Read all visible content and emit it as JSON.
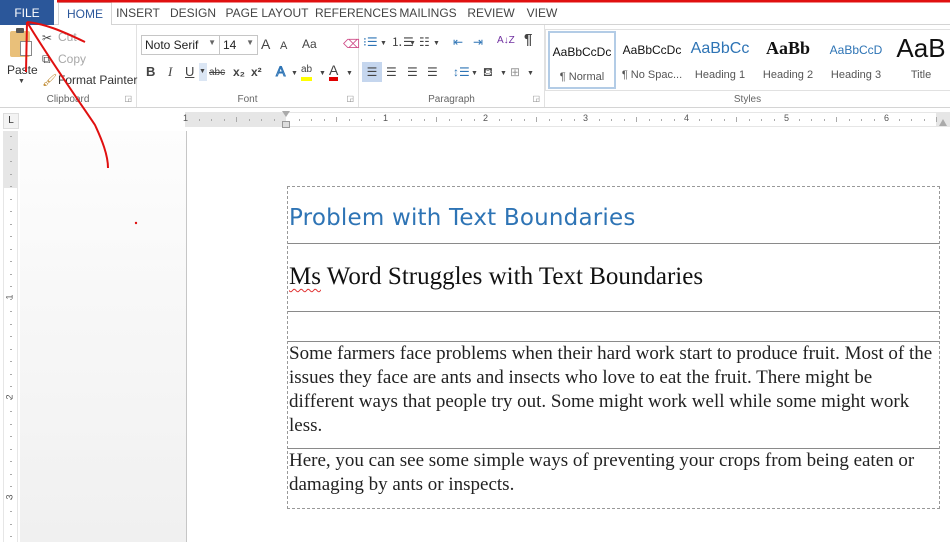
{
  "tabs": [
    {
      "label": "FILE"
    },
    {
      "label": "HOME"
    },
    {
      "label": "INSERT"
    },
    {
      "label": "DESIGN"
    },
    {
      "label": "PAGE LAYOUT"
    },
    {
      "label": "REFERENCES"
    },
    {
      "label": "MAILINGS"
    },
    {
      "label": "REVIEW"
    },
    {
      "label": "VIEW"
    }
  ],
  "active_tab": "HOME",
  "clipboard": {
    "paste": "Paste",
    "cut": "Cut",
    "copy": "Copy",
    "format_painter": "Format Painter",
    "group_label": "Clipboard"
  },
  "font": {
    "family": "Noto Serif",
    "size": "14",
    "grow": "A",
    "shrink": "A",
    "change_case": "Aa",
    "bold": "B",
    "italic": "I",
    "underline": "U",
    "strikethrough": "abc",
    "subscript": "x₂",
    "superscript": "x²",
    "text_effects": "A",
    "highlight": "ab",
    "font_color": "A",
    "group_label": "Font",
    "highlight_color": "#ffff00",
    "font_color_value": "#e00000"
  },
  "paragraph": {
    "group_label": "Paragraph",
    "sort": "A↓Z",
    "show_marks": "¶"
  },
  "styles": {
    "group_label": "Styles",
    "items": [
      {
        "preview": "AaBbCcDc",
        "name": "¶ Normal",
        "selected": true
      },
      {
        "preview": "AaBbCcDc",
        "name": "¶ No Spac..."
      },
      {
        "preview": "AaBbCc",
        "name": "Heading 1"
      },
      {
        "preview": "AaBb",
        "name": "Heading 2"
      },
      {
        "preview": "AaBbCcD",
        "name": "Heading 3"
      },
      {
        "preview": "AaB",
        "name": "Title"
      }
    ]
  },
  "ruler": {
    "corner": "L",
    "h_labels": [
      "1",
      "1",
      "2",
      "3",
      "4",
      "5",
      "6"
    ],
    "v_labels": [
      "1",
      "2",
      "3"
    ]
  },
  "document": {
    "heading": "Problem with Text Boundaries",
    "subtitle_misspelled": "Ms",
    "subtitle_rest": " Word Struggles with Text Boundaries",
    "paragraph1": "Some farmers face problems when their hard work start to produce fruit. Most of the issues they face are ants and insects who love to eat the fruit. There might be different ways that people try out. Some might work well while some might work less.",
    "paragraph2": "Here, you can see some simple ways of preventing your crops from being eaten or damaging by ants or inspects.",
    "heading_color": "#2e74b5"
  },
  "colors": {
    "accent": "#2b579a",
    "annotation": "#e01010"
  }
}
